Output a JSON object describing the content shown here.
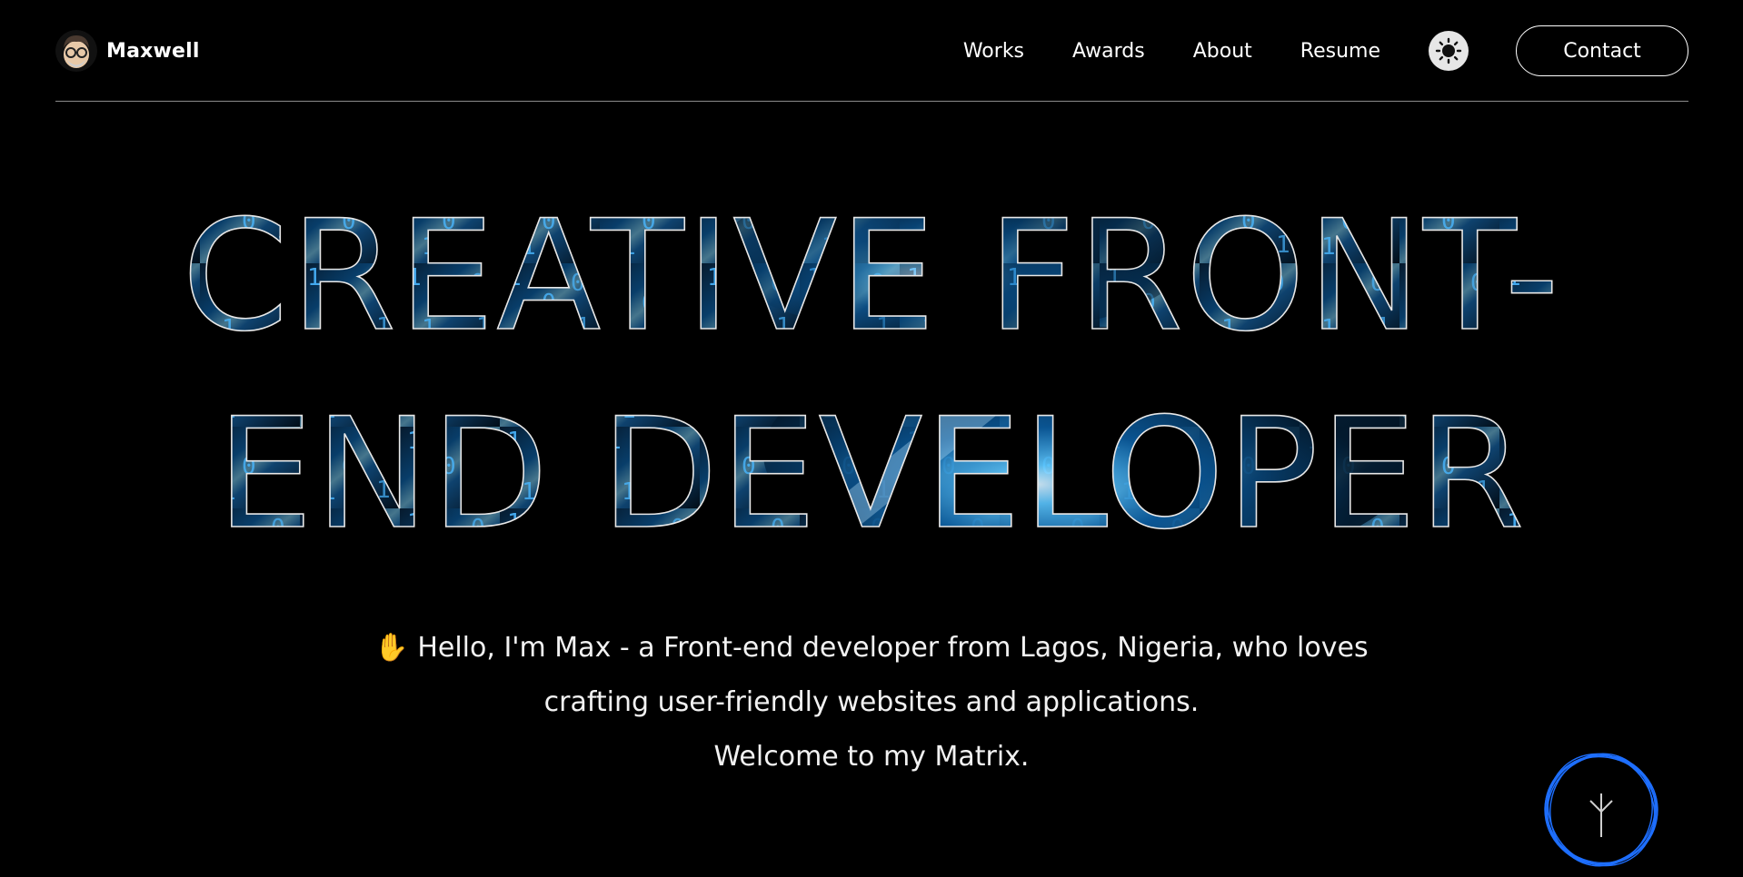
{
  "brand": {
    "name": "Maxwell",
    "avatar_icon": "avatar-icon"
  },
  "nav": {
    "links": [
      {
        "label": "Works"
      },
      {
        "label": "Awards"
      },
      {
        "label": "About"
      },
      {
        "label": "Resume"
      }
    ],
    "theme_toggle_icon": "sun-icon",
    "contact_label": "Contact"
  },
  "hero": {
    "line1": "CREATIVE FRONT-",
    "line2": "END DEVELOPER"
  },
  "intro": {
    "wave_emoji": "✋",
    "line1": "Hello, I'm Max - a Front-end developer from Lagos, Nigeria, who loves",
    "line2": "crafting user-friendly websites and applications.",
    "line3": "Welcome to my Matrix."
  },
  "scroll_badge": {
    "icon": "arrow-down-icon"
  },
  "colors": {
    "background": "#000000",
    "text": "#ffffff",
    "accent_blue": "#1e90ff",
    "toggle_bg": "#e6e6e6",
    "divider": "#8a8a8a"
  }
}
